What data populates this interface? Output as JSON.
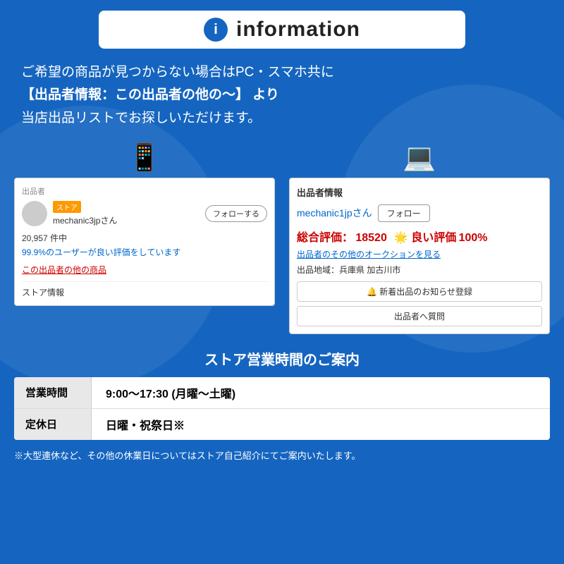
{
  "header": {
    "icon_label": "i",
    "title": "information"
  },
  "description": {
    "line1": "ご希望の商品が見つからない場合はPC・スマホ共に",
    "line2": "【出品者情報：この出品者の他の〜】 より",
    "line3": "当店出品リストでお探しいただけます。"
  },
  "mobile_screenshot": {
    "seller_label": "出品者",
    "store_badge": "ストア",
    "seller_name": "mechanic3jpさん",
    "follow_btn": "フォローする",
    "count": "20,957 件中",
    "rating": "99.9%のユーザーが良い評価をしています",
    "other_items": "この出品者の他の商品",
    "store_info": "ストア情報"
  },
  "pc_screenshot": {
    "seller_info_label": "出品者情報",
    "seller_name": "mechanic1jpさん",
    "follow_btn": "フォロー",
    "rating_label": "総合評価：",
    "rating_value": "18520",
    "good_label": "🌟 良い評価",
    "good_value": "100%",
    "auction_link": "出品者のその他のオークションを見る",
    "location_label": "出品地域：兵庫県 加古川市",
    "notification_btn": "🔔 新着出品のお知らせ登録",
    "question_btn": "出品者へ質問"
  },
  "store_hours": {
    "title": "ストア営業時間のご案内",
    "rows": [
      {
        "label": "営業時間",
        "value": "9:00〜17:30 (月曜〜土曜)"
      },
      {
        "label": "定休日",
        "value": "日曜・祝祭日※"
      }
    ]
  },
  "footer": {
    "note": "※大型連休など、その他の休業日についてはストア自己紹介にてご案内いたします。"
  },
  "icons": {
    "mobile": "📱",
    "pc": "💻"
  }
}
